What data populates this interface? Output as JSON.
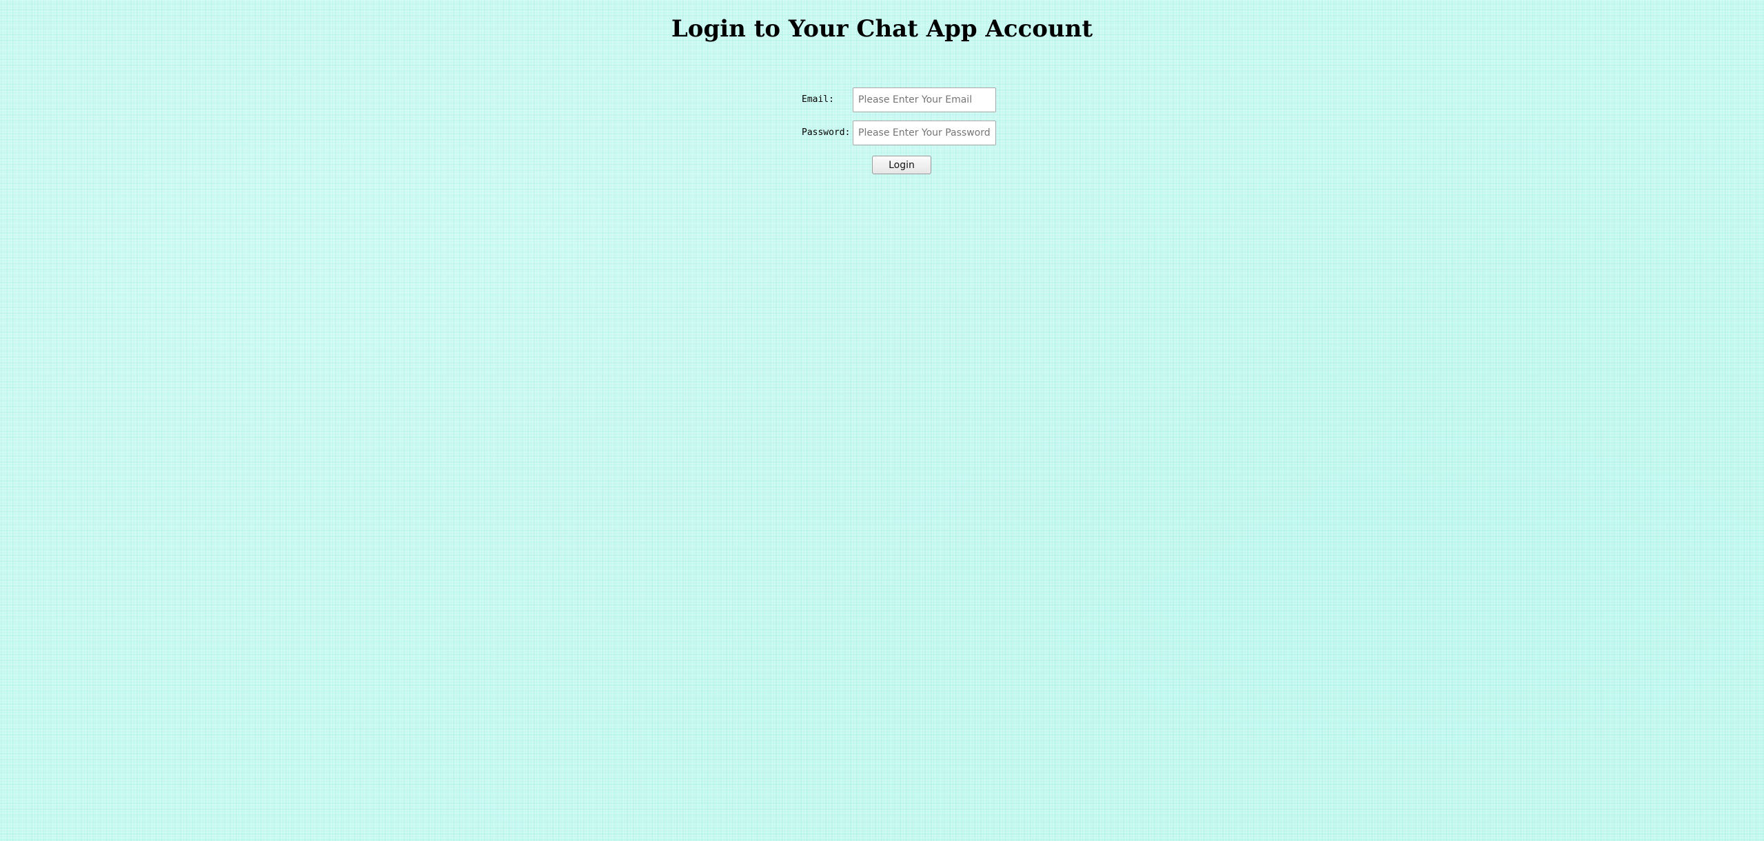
{
  "header": {
    "title": "Login to Your Chat App Account"
  },
  "login_form": {
    "email": {
      "label": "Email:",
      "placeholder": "Please Enter Your Email",
      "value": ""
    },
    "password": {
      "label": "Password:",
      "placeholder": "Please Enter Your Password",
      "value": ""
    },
    "submit_label": "Login"
  },
  "colors": {
    "background": "#c4f9f0",
    "title_text": "#000000"
  }
}
